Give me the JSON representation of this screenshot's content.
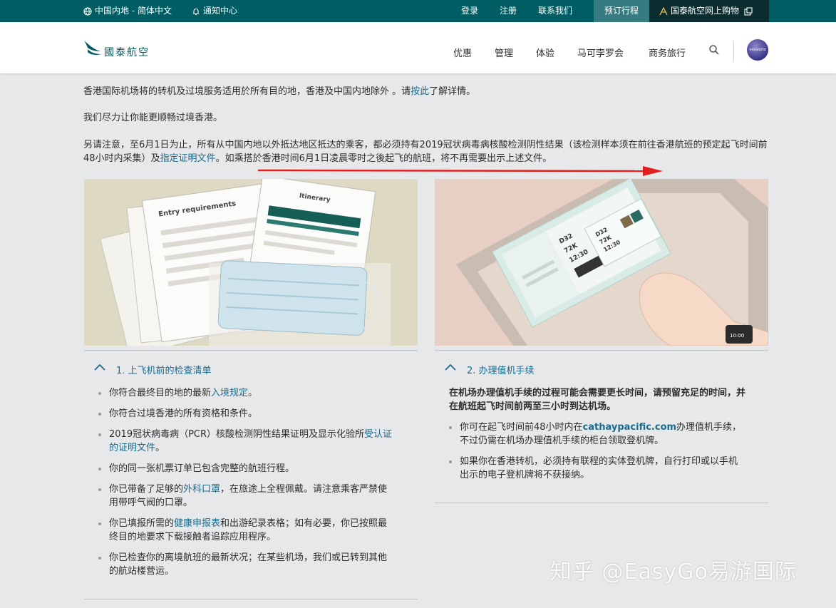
{
  "topbar": {
    "region": "中国内地 - 简体中文",
    "notifications": "通知中心",
    "login": "登录",
    "register": "注册",
    "contact": "联系我们",
    "manage_booking": "预订行程",
    "shop": "国泰航空网上购物"
  },
  "header": {
    "brand": "國泰航空",
    "nav": [
      "优惠",
      "管理",
      "体验",
      "马可孛罗会",
      "商务旅行"
    ],
    "oneworld": "oneworld"
  },
  "intro": {
    "p1_before": "香港国际机场将的转机及过境服务适用於所有目的地，香港及中国内地除外 。请",
    "p1_link": "按此",
    "p1_after": "了解详情。",
    "p2": "我们尽力让你能更顺畅过境香港。",
    "p3_before": "另请注意，至6月1日为止，所有从中国内地以外抵达地区抵达的乘客，都必须持有2019冠状病毒病核酸检测阴性结果（该检测样本须在前往香港航班的预定起飞时间前48小时内采集）及",
    "p3_link": "指定证明文件",
    "p3_after": "。如乘搭於香港时间6月1日凌晨零时之後起飞的航班，将不再需要出示上述文件。"
  },
  "images": {
    "left_doc1": "Entry requirements",
    "left_doc2": "Itinerary",
    "right_pass1": [
      "D32",
      "72K",
      "12:30"
    ],
    "right_pass2": [
      "D32",
      "72K",
      "12:30"
    ],
    "watch": "10:00"
  },
  "section1": {
    "title": "1. 上飞机前的检查清单",
    "items": [
      {
        "before": "你符合最终目的地的最新",
        "link": "入境规定",
        "after": "。"
      },
      {
        "before": "你符合过境香港的所有资格和条件。",
        "link": "",
        "after": ""
      },
      {
        "before": "2019冠状病毒病（PCR）核酸检测阴性结果证明及显示化验所",
        "link": "受认证的证明文件",
        "after": "。"
      },
      {
        "before": "你的同一张机票订单已包含完整的航班行程。",
        "link": "",
        "after": ""
      },
      {
        "before": "你已带备了足够的",
        "link": "外科口罩",
        "after": "，在旅途上全程佩戴。请注意乘客严禁使用带呼气阀的口罩。"
      },
      {
        "before": "你已填报所需的",
        "link": "健康申报表",
        "after": "和出游纪录表格；如有必要，你已按照最终目的地要求下载接触者追踪应用程序。"
      },
      {
        "before": "你已检查你的离境航班的最新状况；在某些机场，我们或已转到其他的航站楼营运。",
        "link": "",
        "after": ""
      }
    ]
  },
  "section2": {
    "title": "2. 办理值机手续",
    "note": "在机场办理值机手续的过程可能会需要更长时间，请预留充足的时间，并在航班起飞时间前两至三小时到达机场。",
    "items": [
      {
        "before": "你可在起飞时间前48小时内在",
        "link": "cathaypacific.com",
        "after": "办理值机手续，不过仍需在机场办理值机手续的柜台领取登机牌。"
      },
      {
        "before": "如果你在香港转机，必须持有联程的实体登机牌，自行打印或以手机出示的电子登机牌将不获接纳。",
        "link": "",
        "after": ""
      }
    ]
  },
  "watermark": "知乎 @EasyGo易游国际",
  "colors": {
    "topbar": "#005d63",
    "link": "#1b6a90",
    "arrow": "#e02020"
  }
}
